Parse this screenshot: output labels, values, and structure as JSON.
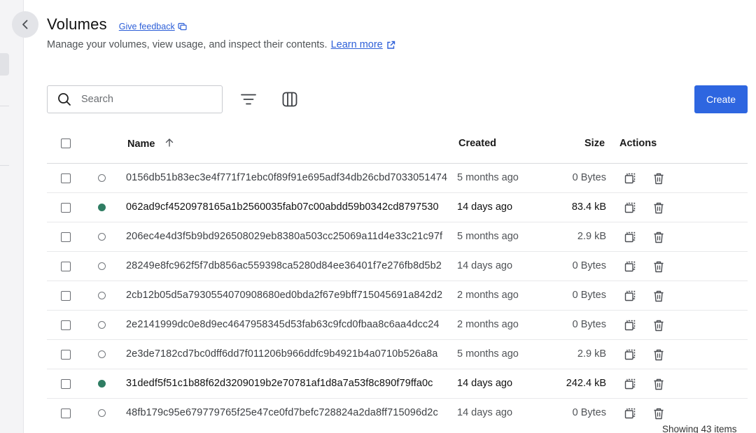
{
  "header": {
    "title": "Volumes",
    "feedback_label": "Give feedback",
    "subtitle": "Manage your volumes, view usage, and inspect their contents.",
    "learn_more_label": "Learn more"
  },
  "toolbar": {
    "search_placeholder": "Search",
    "create_label": "Create"
  },
  "table": {
    "columns": {
      "name": "Name",
      "created": "Created",
      "size": "Size",
      "actions": "Actions"
    },
    "rows": [
      {
        "name": "0156db51b83ec3e4f771f71ebc0f89f91e695adf34db26cbd7033051474",
        "created": "5 months ago",
        "size": "0 Bytes",
        "in_use": false
      },
      {
        "name": "062ad9cf4520978165a1b2560035fab07c00abdd59b0342cd8797530",
        "created": "14 days ago",
        "size": "83.4 kB",
        "in_use": true
      },
      {
        "name": "206ec4e4d3f5b9bd926508029eb8380a503cc25069a11d4e33c21c97f",
        "created": "5 months ago",
        "size": "2.9 kB",
        "in_use": false
      },
      {
        "name": "28249e8fc962f5f7db856ac559398ca5280d84ee36401f7e276fb8d5b2",
        "created": "14 days ago",
        "size": "0 Bytes",
        "in_use": false
      },
      {
        "name": "2cb12b05d5a7930554070908680ed0bda2f67e9bff715045691a842d2",
        "created": "2 months ago",
        "size": "0 Bytes",
        "in_use": false
      },
      {
        "name": "2e2141999dc0e8d9ec4647958345d53fab63c9fcd0fbaa8c6aa4dcc24",
        "created": "2 months ago",
        "size": "0 Bytes",
        "in_use": false
      },
      {
        "name": "2e3de7182cd7bc0dff6dd7f011206b966ddfc9b4921b4a0710b526a8a",
        "created": "5 months ago",
        "size": "2.9 kB",
        "in_use": false
      },
      {
        "name": "31dedf5f51c1b88f62d3209019b2e70781af1d8a7a53f8c890f79ffa0c",
        "created": "14 days ago",
        "size": "242.4 kB",
        "in_use": true
      },
      {
        "name": "48fb179c95e679779765f25e47ce0fd7befc728824a2da8ff715096d2c",
        "created": "14 days ago",
        "size": "0 Bytes",
        "in_use": false
      }
    ]
  },
  "footer": {
    "count_text": "Showing 43 items"
  },
  "colors": {
    "accent": "#2e66e0",
    "link": "#2d5fd8",
    "status_active": "#2f7d63"
  },
  "icons": [
    "chevron-left-icon",
    "external-link-icon",
    "search-icon",
    "filter-icon",
    "columns-icon",
    "sort-ascending-icon",
    "copy-icon",
    "trash-icon"
  ]
}
